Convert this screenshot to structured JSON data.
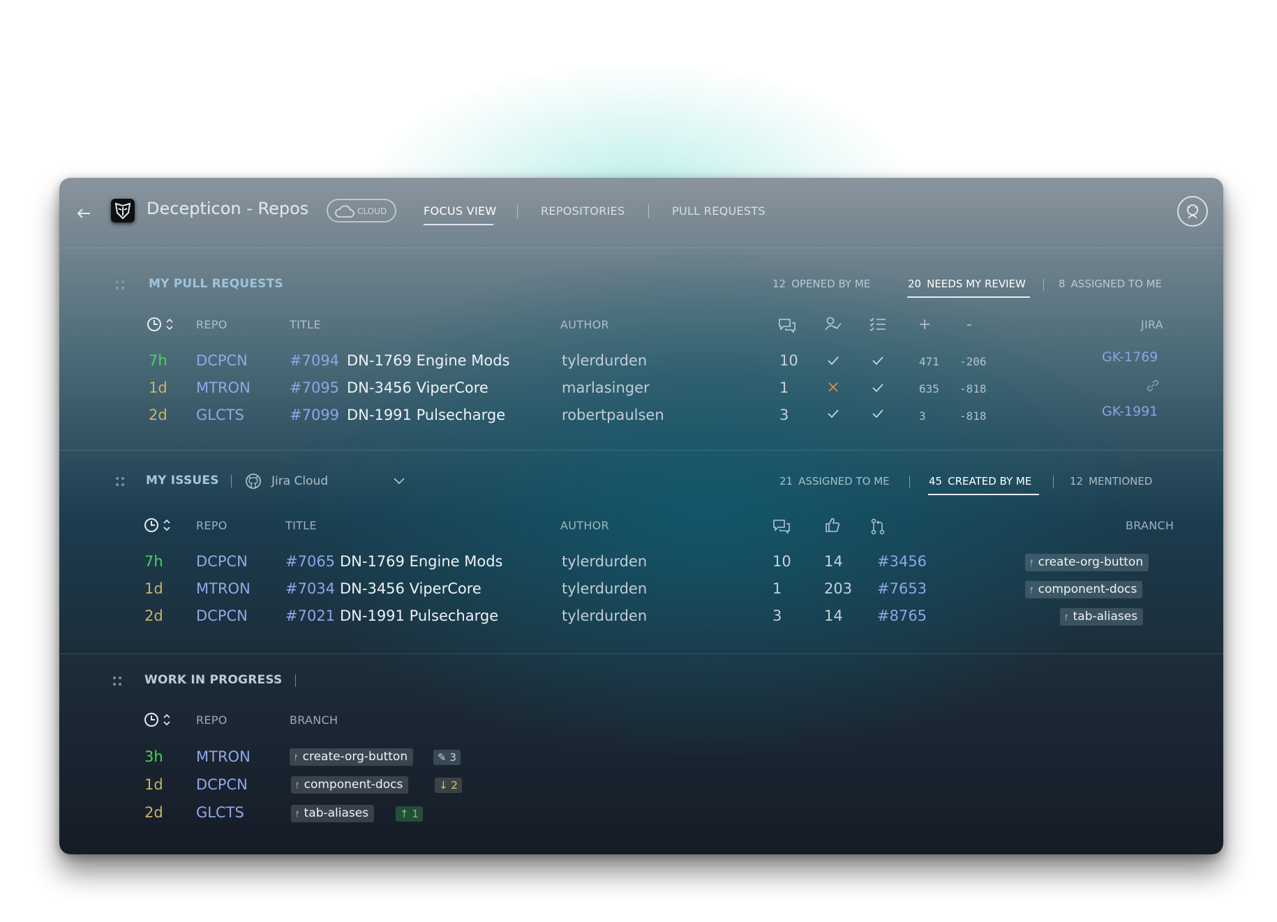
{
  "header": {
    "app_title": "Decepticon - Repos",
    "cloud_label": "CLOUD",
    "tabs": [
      {
        "label": "FOCUS VIEW",
        "active": true
      },
      {
        "label": "REPOSITORIES",
        "active": false
      },
      {
        "label": "PULL REQUESTS",
        "active": false
      }
    ]
  },
  "pull_requests": {
    "title": "MY PULL REQUESTS",
    "filters": [
      {
        "count": "12",
        "label": "OPENED BY ME",
        "active": false
      },
      {
        "count": "20",
        "label": "NEEDS MY REVIEW",
        "active": true
      },
      {
        "count": "8",
        "label": "ASSIGNED TO ME",
        "active": false
      }
    ],
    "columns": {
      "repo": "REPO",
      "title": "TITLE",
      "author": "AUTHOR",
      "added": "+",
      "removed": "-",
      "jira": "JIRA"
    },
    "rows": [
      {
        "age": "7h",
        "age_color": "green",
        "repo": "DCPCN",
        "number": "#7094",
        "title": "DN-1769 Engine Mods",
        "author": "tylerdurden",
        "comments": "10",
        "reviewers": "approved",
        "checks": "passed",
        "added": "471",
        "removed": "-206",
        "jira": "GK-1769"
      },
      {
        "age": "1d",
        "age_color": "yellow",
        "repo": "MTRON",
        "number": "#7095",
        "title": "DN-3456 ViperCore",
        "author": "marlasinger",
        "comments": "1",
        "reviewers": "rejected",
        "checks": "passed",
        "added": "635",
        "removed": "-818",
        "jira": ""
      },
      {
        "age": "2d",
        "age_color": "yellow",
        "repo": "GLCTS",
        "number": "#7099",
        "title": "DN-1991 Pulsecharge",
        "author": "robertpaulsen",
        "comments": "3",
        "reviewers": "approved",
        "checks": "passed",
        "added": "3",
        "removed": "-818",
        "jira": "GK-1991"
      }
    ]
  },
  "issues": {
    "title": "MY ISSUES",
    "source": "Jira Cloud",
    "filters": [
      {
        "count": "21",
        "label": "ASSIGNED TO ME",
        "active": false
      },
      {
        "count": "45",
        "label": "CREATED BY ME",
        "active": true
      },
      {
        "count": "12",
        "label": "MENTIONED",
        "active": false
      }
    ],
    "columns": {
      "repo": "REPO",
      "title": "TITLE",
      "author": "AUTHOR",
      "branch": "BRANCH"
    },
    "rows": [
      {
        "age": "7h",
        "repo": "DCPCN",
        "number": "#7065",
        "title": "DN-1769 Engine Mods",
        "author": "tylerdurden",
        "comments": "10",
        "likes": "14",
        "pr": "#3456",
        "branch": "create-org-button"
      },
      {
        "age": "1d",
        "repo": "MTRON",
        "number": "#7034",
        "title": "DN-3456 ViperCore",
        "author": "tylerdurden",
        "comments": "1",
        "likes": "203",
        "pr": "#7653",
        "branch": "component-docs"
      },
      {
        "age": "2d",
        "repo": "DCPCN",
        "number": "#7021",
        "title": "DN-1991 Pulsecharge",
        "author": "tylerdurden",
        "comments": "3",
        "likes": "14",
        "pr": "#8765",
        "branch": "tab-aliases"
      }
    ]
  },
  "wip": {
    "title": "WORK IN PROGRESS",
    "columns": {
      "repo": "REPO",
      "branch": "BRANCH"
    },
    "rows": [
      {
        "age": "3h",
        "repo": "MTRON",
        "branch": "create-org-button",
        "badge": "3",
        "badge_type": "edited"
      },
      {
        "age": "1d",
        "repo": "DCPCN",
        "branch": "component-docs",
        "badge": "2",
        "badge_type": "behind"
      },
      {
        "age": "2d",
        "repo": "GLCTS",
        "branch": "tab-aliases",
        "badge": "1",
        "badge_type": "ahead"
      }
    ]
  },
  "colors": {
    "age_green": "#48d35a",
    "age_yellow": "#c8b468",
    "link_blue": "#8ea6e8",
    "rejected": "#e08a4a"
  }
}
